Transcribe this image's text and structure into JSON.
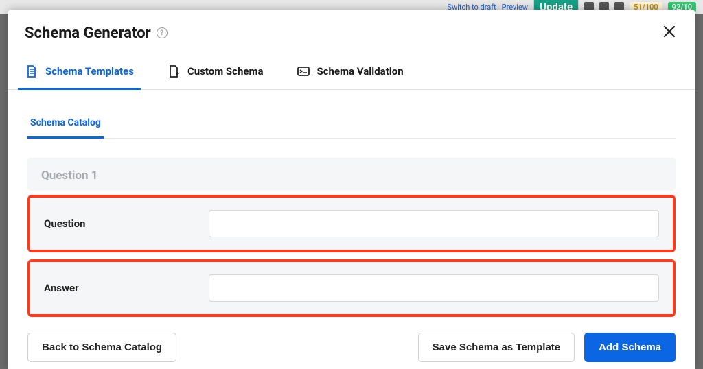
{
  "backdrop": {
    "switch_draft": "Switch to draft",
    "preview": "Preview",
    "update": "Update",
    "pill_a": "51/100",
    "pill_b": "92/10"
  },
  "modal": {
    "title": "Schema Generator"
  },
  "tabs": {
    "primary": [
      {
        "label": "Schema Templates",
        "active": true
      },
      {
        "label": "Custom Schema",
        "active": false
      },
      {
        "label": "Schema Validation",
        "active": false
      }
    ],
    "secondary": "Schema Catalog"
  },
  "form": {
    "section_title": "Question 1",
    "fields": {
      "question": {
        "label": "Question",
        "value": ""
      },
      "answer": {
        "label": "Answer",
        "value": ""
      }
    }
  },
  "footer": {
    "back": "Back to Schema Catalog",
    "save_template": "Save Schema as Template",
    "add_schema": "Add Schema"
  }
}
